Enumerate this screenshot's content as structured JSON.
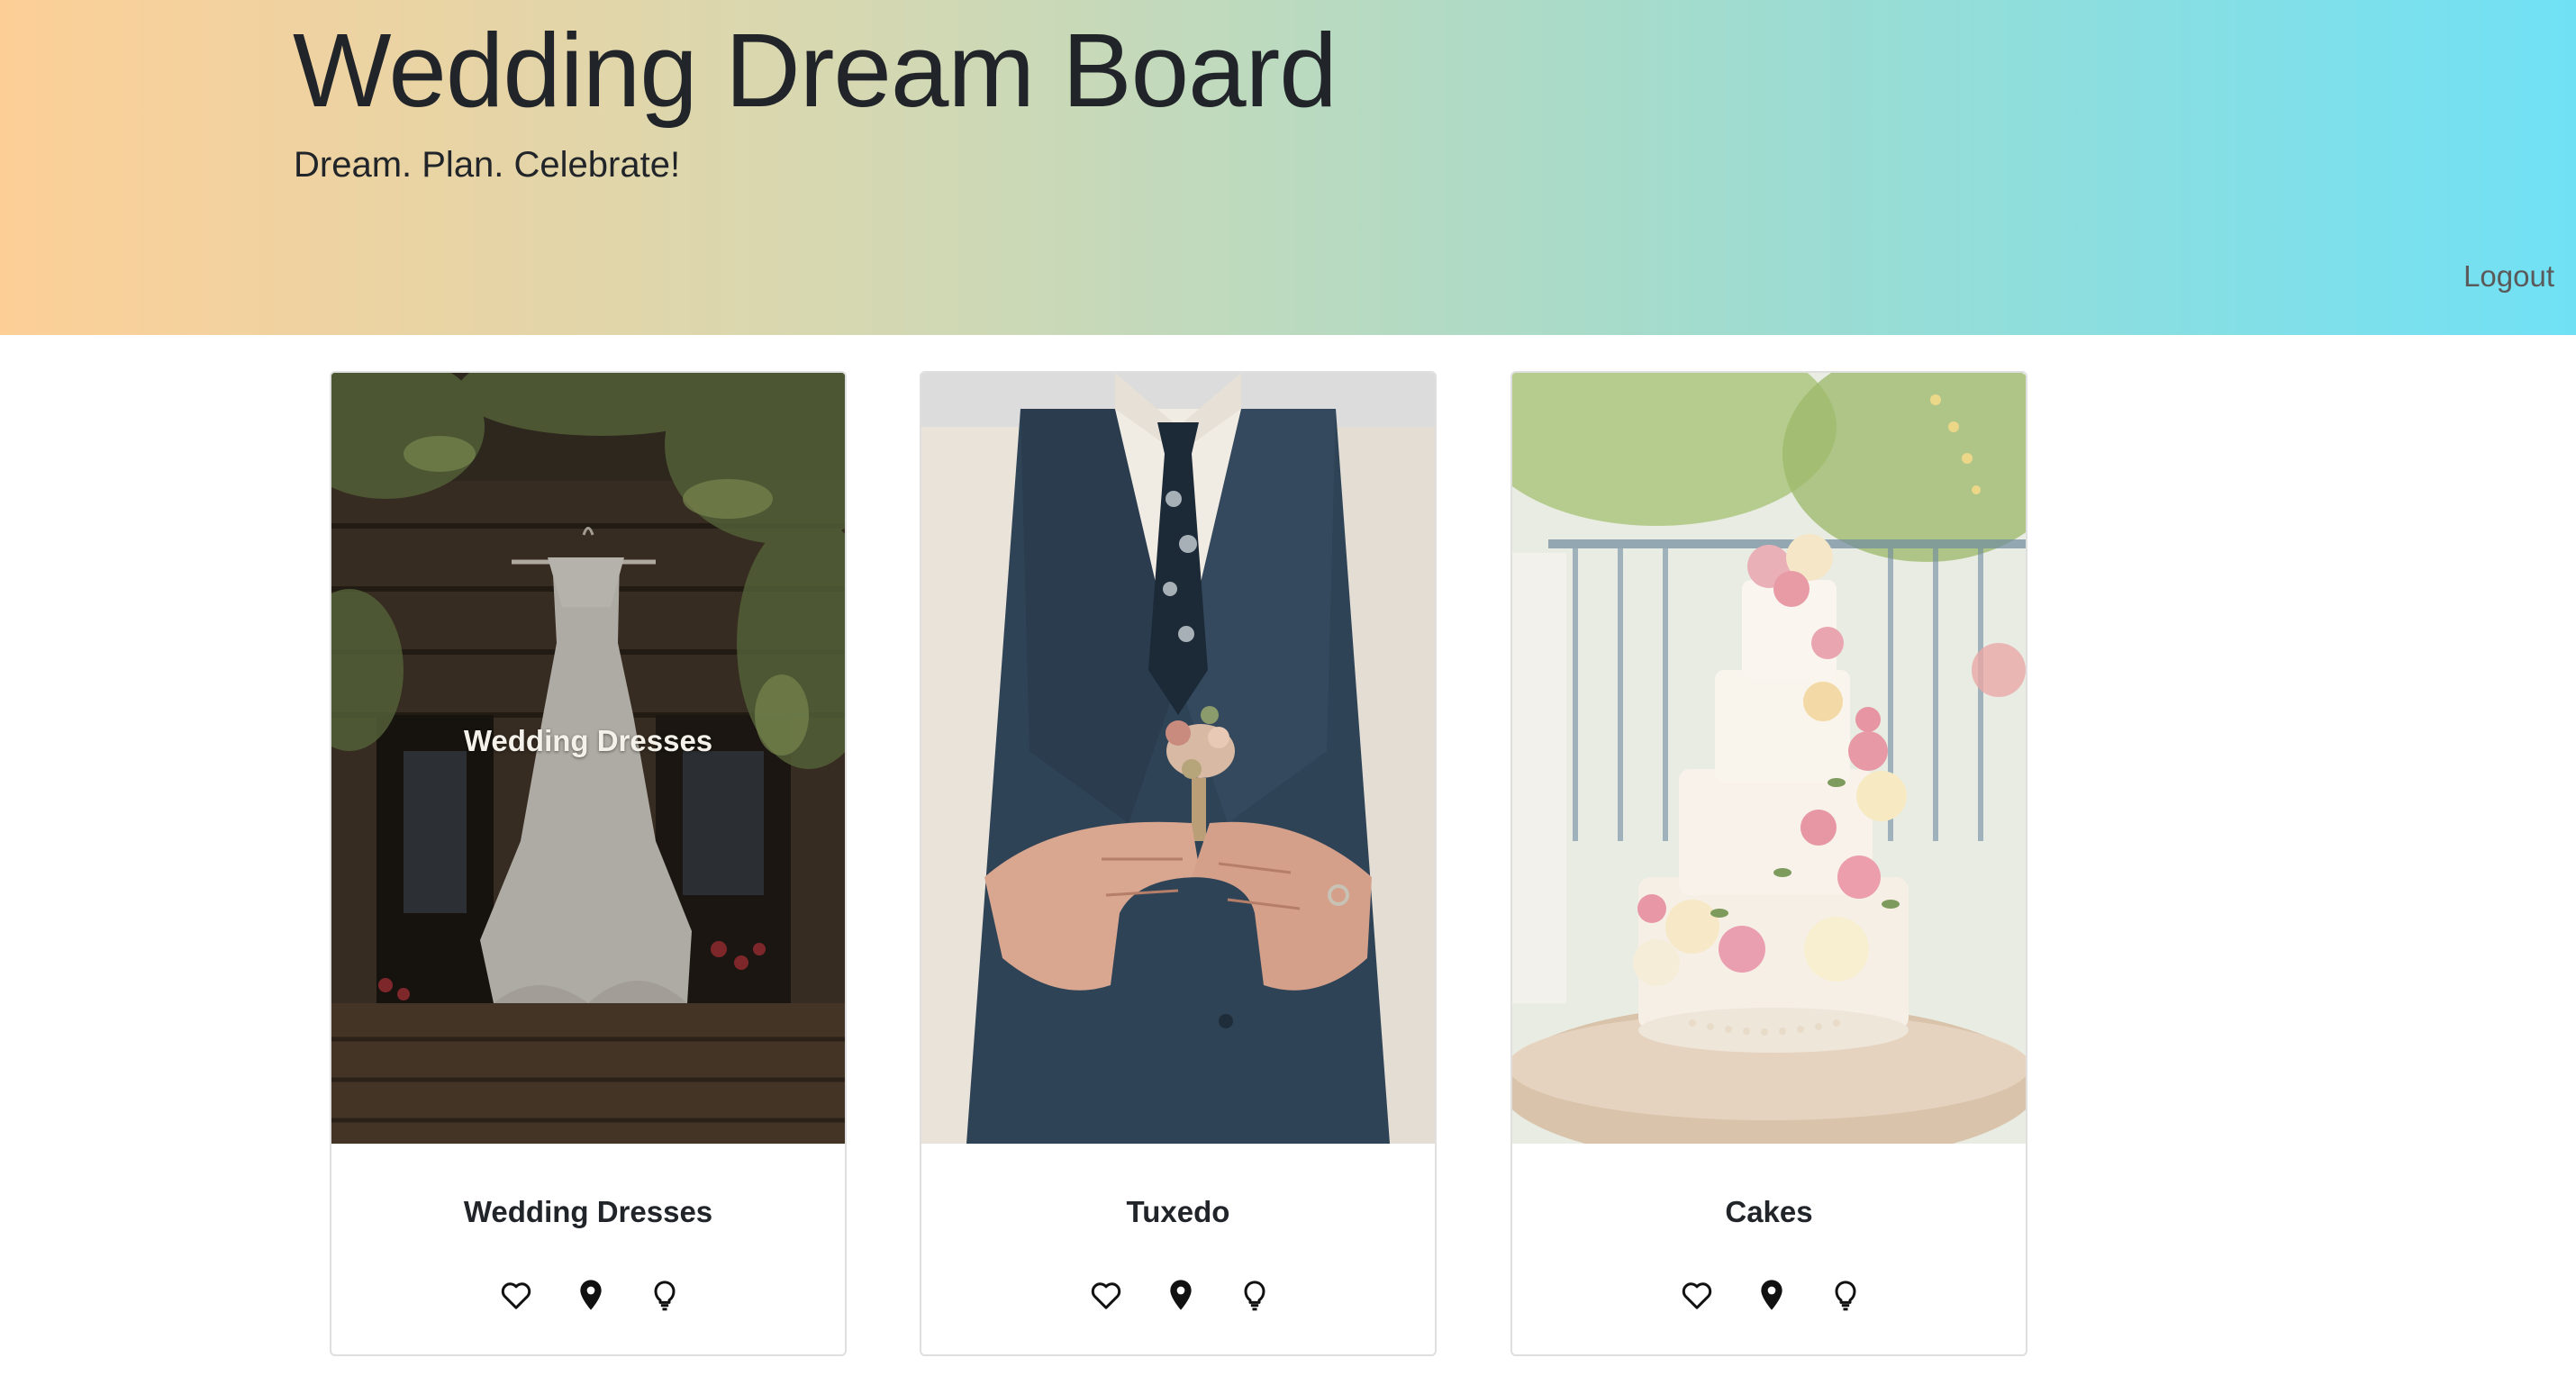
{
  "header": {
    "title": "Wedding Dream Board",
    "tagline": "Dream. Plan. Celebrate!",
    "logout_label": "Logout",
    "gradient_colors": [
      "#fdcf97",
      "#70e1f5"
    ]
  },
  "cards": [
    {
      "title": "Wedding Dresses",
      "overlay_label": "Wedding Dresses",
      "image": "wedding-dress-photo",
      "actions": [
        "heart-icon",
        "map-pin-icon",
        "lightbulb-icon"
      ]
    },
    {
      "title": "Tuxedo",
      "image": "tuxedo-boutonniere-photo",
      "actions": [
        "heart-icon",
        "map-pin-icon",
        "lightbulb-icon"
      ]
    },
    {
      "title": "Cakes",
      "image": "wedding-cake-photo",
      "actions": [
        "heart-icon",
        "map-pin-icon",
        "lightbulb-icon"
      ]
    }
  ]
}
